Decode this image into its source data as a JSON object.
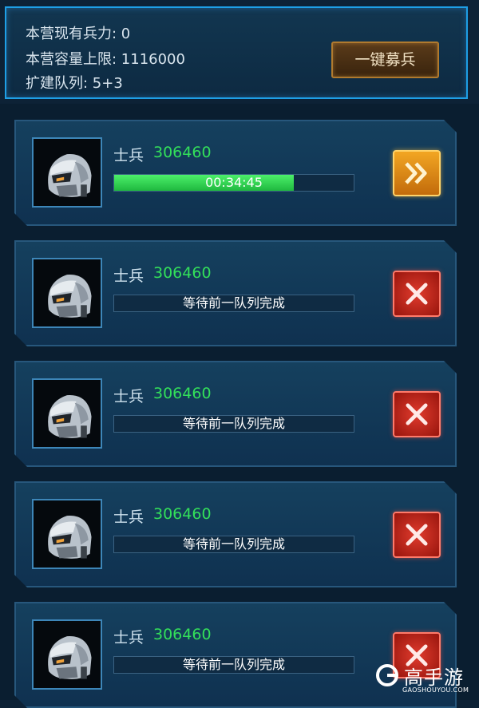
{
  "camp": {
    "troops_label": "本营现有兵力",
    "troops_value": "0",
    "capacity_label": "本营容量上限",
    "capacity_value": "1116000",
    "queues_label": "扩建队列",
    "queues_value": "5+3",
    "separator": ": ",
    "recruit_all_label": "一键募兵"
  },
  "queue": [
    {
      "unit": "士兵",
      "count": "306460",
      "status": "00:34:45",
      "progress": 0.75,
      "action": "speed-up"
    },
    {
      "unit": "士兵",
      "count": "306460",
      "status": "等待前一队列完成",
      "progress": 0,
      "action": "cancel"
    },
    {
      "unit": "士兵",
      "count": "306460",
      "status": "等待前一队列完成",
      "progress": 0,
      "action": "cancel"
    },
    {
      "unit": "士兵",
      "count": "306460",
      "status": "等待前一队列完成",
      "progress": 0,
      "action": "cancel"
    },
    {
      "unit": "士兵",
      "count": "306460",
      "status": "等待前一队列完成",
      "progress": 0,
      "action": "cancel"
    }
  ],
  "watermark": {
    "title": "高手游",
    "url": "GAOSHOUYOU.COM"
  },
  "colors": {
    "accent_border": "#1e9fe6",
    "count_green": "#33e05a",
    "speed_orange": "#f2a623",
    "cancel_red": "#e03b2d"
  }
}
